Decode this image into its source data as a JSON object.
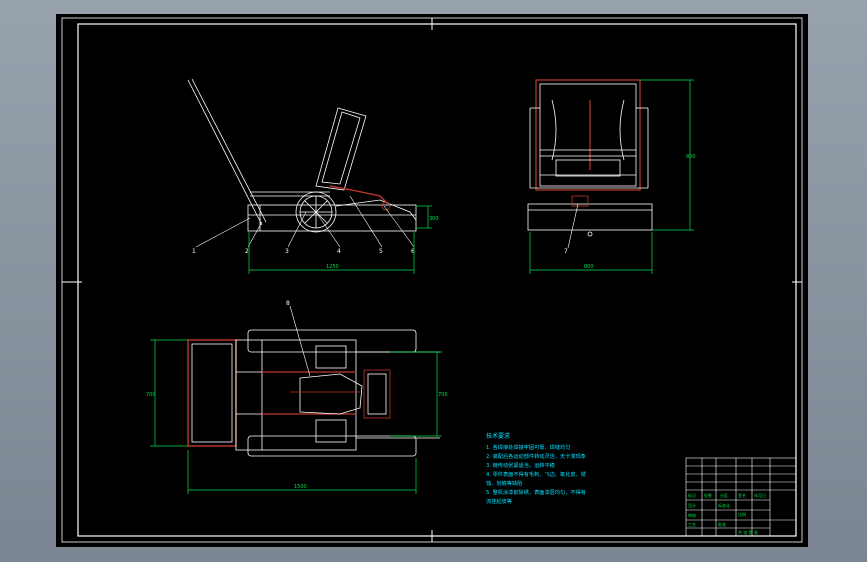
{
  "colors": {
    "sheet": "#000000",
    "frame": "#ffffff",
    "part": "#ffffff",
    "highlight": "#c0392b",
    "dimension": "#00e04a",
    "notes": "#00e0ff",
    "table_text": "#00e04a"
  },
  "views": {
    "side": {
      "part_labels": [
        "1",
        "2",
        "3",
        "4",
        "5",
        "6"
      ],
      "dim_length": "1250",
      "dim_height": "300"
    },
    "front": {
      "part_label": "7",
      "dim_width": "800",
      "dim_height": "800"
    },
    "top": {
      "part_label": "8",
      "dim_width": "700",
      "dim_depth": "700",
      "dim_length": "1500"
    }
  },
  "notes": {
    "title": "技术要求",
    "lines": [
      "1. 各焊接处焊接牢固可靠，焊缝均匀",
      "2. 装配后各运动部件转动灵活，无卡滞现象",
      "3. 链传动张紧适当，运转平稳",
      "4. 零件表面不得有毛刺、飞边、氧化皮、锈",
      "蚀、划痕等缺陷",
      "5. 整机涂漆前除锈，表面漆层均匀，不得有",
      "流挂起皮等"
    ]
  },
  "title_block": {
    "rows": [
      [
        "",
        "",
        "",
        "",
        ""
      ],
      [
        "",
        "",
        "",
        "",
        ""
      ],
      [
        "",
        "",
        "",
        "",
        ""
      ],
      [
        "标记",
        "处数",
        "分区",
        "签名",
        "年月日"
      ],
      [
        "设计",
        "",
        "标准化",
        "",
        ""
      ],
      [
        "审核",
        "",
        "",
        "",
        ""
      ],
      [
        "工艺",
        "",
        "批准",
        "",
        ""
      ]
    ],
    "scale_label": "比例",
    "sheet_label": "共 张 第 张"
  }
}
